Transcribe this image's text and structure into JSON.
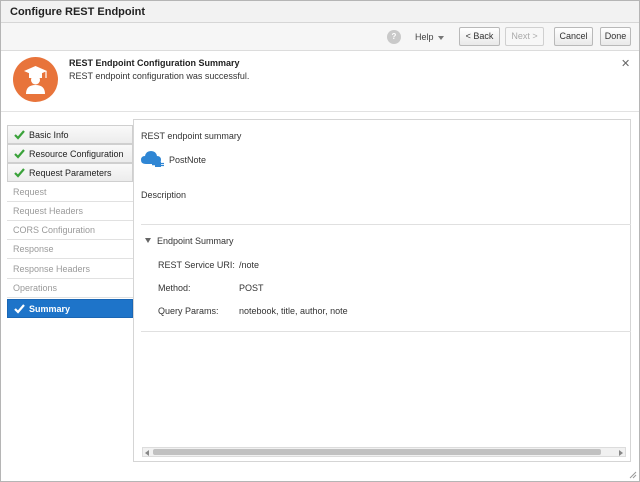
{
  "window": {
    "title": "Configure REST Endpoint"
  },
  "toolbar": {
    "help_icon_glyph": "?",
    "help_label": "Help",
    "back_label": "< Back",
    "next_label": "Next >",
    "cancel_label": "Cancel",
    "done_label": "Done"
  },
  "banner": {
    "icon": "graduate-badge-icon",
    "heading": "REST Endpoint Configuration Summary",
    "message": "REST endpoint configuration was successful.",
    "close_glyph": "✕",
    "accent_color": "#e8743b"
  },
  "nav": {
    "items": [
      {
        "label": "Basic Info",
        "state": "done"
      },
      {
        "label": "Resource Configuration",
        "state": "done"
      },
      {
        "label": "Request Parameters",
        "state": "done"
      },
      {
        "label": "Request",
        "state": "pending"
      },
      {
        "label": "Request Headers",
        "state": "pending"
      },
      {
        "label": "CORS Configuration",
        "state": "pending"
      },
      {
        "label": "Response",
        "state": "pending"
      },
      {
        "label": "Response Headers",
        "state": "pending"
      },
      {
        "label": "Operations",
        "state": "pending"
      },
      {
        "label": "Summary",
        "state": "active"
      }
    ],
    "active_color": "#1e74c9",
    "check_color": "#3aa23a"
  },
  "main": {
    "summary_title": "REST endpoint summary",
    "endpoint_name": "PostNote",
    "description_label": "Description",
    "section_title": "Endpoint Summary",
    "fields": [
      {
        "label": "REST Service URI:",
        "value": "/note"
      },
      {
        "label": "Method:",
        "value": "POST"
      },
      {
        "label": "Query Params:",
        "value": "notebook, title, author, note"
      }
    ]
  }
}
